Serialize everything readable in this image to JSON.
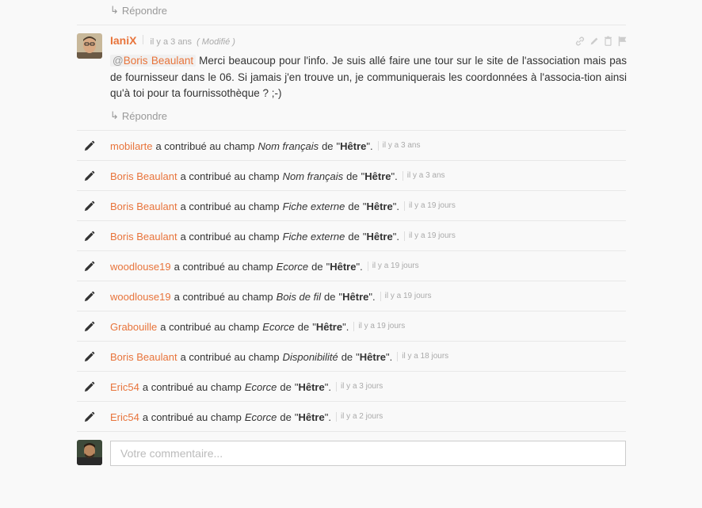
{
  "top_reply": {
    "label": "Répondre"
  },
  "comment": {
    "author": "IaniX",
    "time": "il y a 3 ans",
    "modified": "( Modifié )",
    "mention_at": "@",
    "mention_name": "Boris Beaulant",
    "text": "Merci beaucoup pour l'info. Je suis allé faire une tour sur le site de l'association mais pas de fournisseur dans le 06. Si jamais j'en trouve un, je communiquerais les coordonnées à l'associa-tion ainsi qu'à toi pour ta fournissothèque ? ;-)",
    "reply_label": "Répondre"
  },
  "activity_text": {
    "contributed": "a contribué au champ",
    "de": "de",
    "quote_open": "\"",
    "quote_close": "\"."
  },
  "activities": [
    {
      "user": "mobilarte",
      "field": "Nom français",
      "target": "Hêtre",
      "time": "il y a 3 ans"
    },
    {
      "user": "Boris Beaulant",
      "field": "Nom français",
      "target": "Hêtre",
      "time": "il y a 3 ans"
    },
    {
      "user": "Boris Beaulant",
      "field": "Fiche externe",
      "target": "Hêtre",
      "time": "il y a 19 jours"
    },
    {
      "user": "Boris Beaulant",
      "field": "Fiche externe",
      "target": "Hêtre",
      "time": "il y a 19 jours"
    },
    {
      "user": "woodlouse19",
      "field": "Ecorce",
      "target": "Hêtre",
      "time": "il y a 19 jours"
    },
    {
      "user": "woodlouse19",
      "field": "Bois de fil",
      "target": "Hêtre",
      "time": "il y a 19 jours"
    },
    {
      "user": "Grabouille",
      "field": "Ecorce",
      "target": "Hêtre",
      "time": "il y a 19 jours"
    },
    {
      "user": "Boris Beaulant",
      "field": "Disponibilité",
      "target": "Hêtre",
      "time": "il y a 18 jours"
    },
    {
      "user": "Eric54",
      "field": "Ecorce",
      "target": "Hêtre",
      "time": "il y a 3 jours"
    },
    {
      "user": "Eric54",
      "field": "Ecorce",
      "target": "Hêtre",
      "time": "il y a 2 jours"
    }
  ],
  "comment_input": {
    "placeholder": "Votre commentaire..."
  },
  "icons": {
    "reply": "reply-arrow-icon",
    "link": "link-icon",
    "edit": "pencil-icon",
    "delete": "trash-icon",
    "flag": "flag-icon",
    "activity": "pencil-icon"
  },
  "colors": {
    "accent": "#e8743b",
    "muted": "#aaaaaa",
    "divider": "#e8e8e8"
  }
}
